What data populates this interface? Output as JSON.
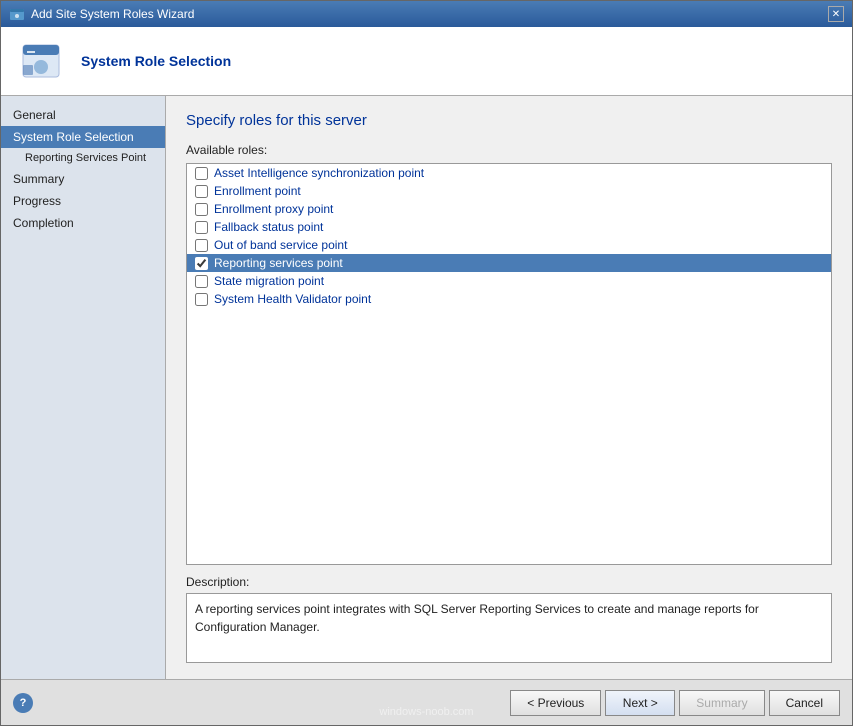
{
  "window": {
    "title": "Add Site System Roles Wizard",
    "close_label": "✕"
  },
  "header": {
    "title": "System Role Selection"
  },
  "sidebar": {
    "items": [
      {
        "label": "General",
        "type": "top",
        "active": false
      },
      {
        "label": "System Role Selection",
        "type": "top",
        "active": true
      },
      {
        "label": "Reporting Services Point",
        "type": "sub",
        "active": false
      },
      {
        "label": "Summary",
        "type": "top",
        "active": false
      },
      {
        "label": "Progress",
        "type": "top",
        "active": false
      },
      {
        "label": "Completion",
        "type": "top",
        "active": false
      }
    ]
  },
  "main": {
    "page_title": "Specify roles for this server",
    "available_roles_label": "Available roles:",
    "roles": [
      {
        "label": "Asset Intelligence synchronization point",
        "checked": false,
        "selected": false
      },
      {
        "label": "Enrollment point",
        "checked": false,
        "selected": false
      },
      {
        "label": "Enrollment proxy point",
        "checked": false,
        "selected": false
      },
      {
        "label": "Fallback status point",
        "checked": false,
        "selected": false
      },
      {
        "label": "Out of band service point",
        "checked": false,
        "selected": false
      },
      {
        "label": "Reporting services point",
        "checked": true,
        "selected": true
      },
      {
        "label": "State migration point",
        "checked": false,
        "selected": false
      },
      {
        "label": "System Health Validator point",
        "checked": false,
        "selected": false
      }
    ],
    "description_label": "Description:",
    "description_text": "A reporting services point integrates with SQL Server Reporting Services to create and manage reports for Configuration Manager."
  },
  "footer": {
    "previous_label": "< Previous",
    "next_label": "Next >",
    "summary_label": "Summary",
    "cancel_label": "Cancel"
  },
  "watermark": "windows-noob.com"
}
